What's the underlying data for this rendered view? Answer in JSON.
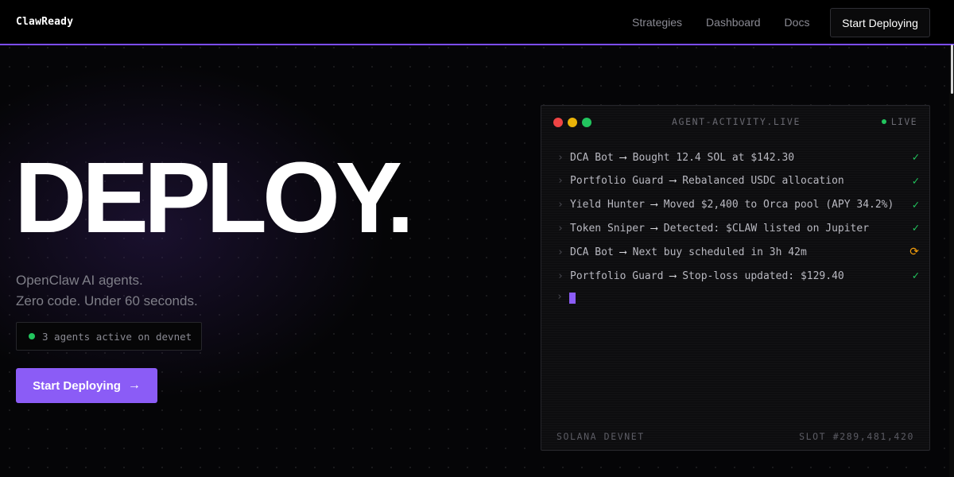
{
  "nav": {
    "brand": "ClawReady",
    "links": [
      "Strategies",
      "Dashboard",
      "Docs"
    ],
    "cta_label": "Start Deploying"
  },
  "hero": {
    "title": "DEPLOY.",
    "subtitle_line1": "OpenClaw AI agents.",
    "subtitle_line2": "Zero code. Under 60 seconds.",
    "status_text": "3 agents active on devnet",
    "cta_label": "Start Deploying",
    "cta_icon": "arrow-right-icon"
  },
  "terminal": {
    "title": "AGENT-ACTIVITY.LIVE",
    "live_label": "LIVE",
    "prompt_glyph": "›",
    "arrow_glyph": "⟶",
    "lines": [
      {
        "agent": "DCA Bot",
        "message": "Bought 12.4 SOL at $142.30",
        "status": "done",
        "status_glyph": "✓"
      },
      {
        "agent": "Portfolio Guard",
        "message": "Rebalanced USDC allocation",
        "status": "done",
        "status_glyph": "✓"
      },
      {
        "agent": "Yield Hunter",
        "message": "Moved $2,400 to Orca pool (APY 34.2%)",
        "status": "done",
        "status_glyph": "✓"
      },
      {
        "agent": "Token Sniper",
        "message": "Detected: $CLAW listed on Jupiter",
        "status": "done",
        "status_glyph": "✓"
      },
      {
        "agent": "DCA Bot",
        "message": "Next buy scheduled in 3h 42m",
        "status": "pending",
        "status_glyph": "⟳"
      },
      {
        "agent": "Portfolio Guard",
        "message": "Stop-loss updated: $129.40",
        "status": "done",
        "status_glyph": "✓"
      }
    ],
    "footer_left": "SOLANA DEVNET",
    "footer_right": "SLOT #289,481,420"
  },
  "colors": {
    "accent": "#8b5cf6",
    "success": "#22c55e",
    "pending": "#f59e0b",
    "window_red": "#ef4444",
    "window_yellow": "#eab308",
    "window_green": "#22c55e"
  }
}
